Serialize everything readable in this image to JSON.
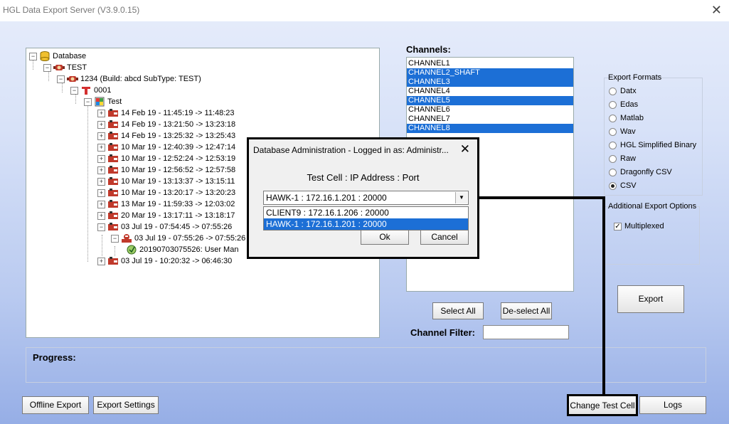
{
  "window": {
    "title": "HGL Data Export Server (V3.9.0.15)",
    "close": "✕"
  },
  "tree": {
    "root": "Database",
    "test": "TEST",
    "build": "1234 (Build: abcd  SubType: TEST)",
    "unit": "0001",
    "testnode": "Test",
    "runs": [
      "14 Feb 19 - 11:45:19 -> 11:48:23",
      "14 Feb 19 - 13:21:50 -> 13:23:18",
      "14 Feb 19 - 13:25:32 -> 13:25:43",
      "10 Mar 19 - 12:40:39 -> 12:47:14",
      "10 Mar 19 - 12:52:24 -> 12:53:19",
      "10 Mar 19 - 12:56:52 -> 12:57:58",
      "10 Mar 19 - 13:13:37 -> 13:15:11",
      "10 Mar 19 - 13:20:17 -> 13:20:23",
      "13 Mar 19 - 11:59:33 -> 12:03:02",
      "20 Mar 19 - 13:17:11 -> 13:18:17",
      "03 Jul 19 - 07:54:45 -> 07:55:26"
    ],
    "subrun": "03 Jul 19 - 07:55:26 -> 07:55:26",
    "leaf": "20190703075526: User Man",
    "lastrun": "03 Jul 19 - 10:20:32 -> 06:46:30"
  },
  "channels": {
    "label": "Channels:",
    "items": [
      {
        "name": "CHANNEL1",
        "selected": false
      },
      {
        "name": "CHANNEL2_SHAFT",
        "selected": true
      },
      {
        "name": "CHANNEL3",
        "selected": true
      },
      {
        "name": "CHANNEL4",
        "selected": false
      },
      {
        "name": "CHANNEL5",
        "selected": true
      },
      {
        "name": "CHANNEL6",
        "selected": false
      },
      {
        "name": "CHANNEL7",
        "selected": false
      },
      {
        "name": "CHANNEL8",
        "selected": true
      }
    ],
    "select_all": "Select All",
    "deselect_all": "De-select All",
    "filter_label": "Channel Filter:",
    "filter_value": ""
  },
  "export_formats": {
    "title": "Export Formats",
    "options": [
      "Datx",
      "Edas",
      "Matlab",
      "Wav",
      "HGL Simplified Binary",
      "Raw",
      "Dragonfly CSV",
      "CSV"
    ],
    "selected": "CSV"
  },
  "additional_options": {
    "title": "Additional Export Options",
    "multiplexed": "Multiplexed",
    "multiplexed_checked": true
  },
  "export_button": "Export",
  "progress_label": "Progress:",
  "bottom": {
    "offline_export": "Offline Export",
    "export_settings": "Export Settings",
    "change_test_cell": "Change Test Cell",
    "logs": "Logs"
  },
  "dialog": {
    "title": "Database Administration - Logged in as: Administr...",
    "heading": "Test Cell : IP Address : Port",
    "selected_value": "HAWK-1 : 172.16.1.201 : 20000",
    "options": [
      "CLIENT9 : 172.16.1.206 : 20000",
      "HAWK-1 : 172.16.1.201 : 20000"
    ],
    "ok": "Ok",
    "cancel": "Cancel"
  },
  "colors": {
    "selection": "#1c6fd6",
    "highlight_border": "#000000"
  }
}
